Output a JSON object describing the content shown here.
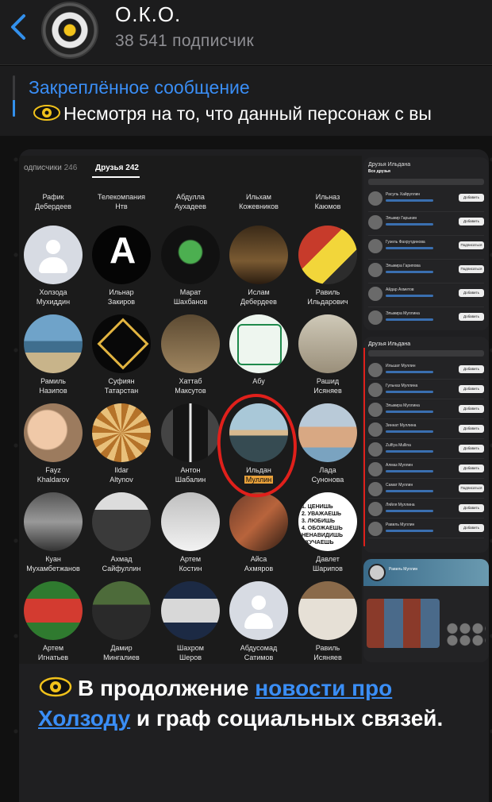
{
  "header": {
    "title": "О.К.О.",
    "subscribers": "38 541 подписчик"
  },
  "pinned": {
    "label": "Закреплённое сообщение",
    "text": "Несмотря на то, что данный персонаж с вы"
  },
  "screenshot_left": {
    "tabs": [
      {
        "label": "одписчики",
        "count": "246"
      },
      {
        "label": "Друзья",
        "count": "242"
      }
    ],
    "friends": [
      {
        "first": "Рафик",
        "last": "Дебердеев",
        "photo": "p-none"
      },
      {
        "first": "Телекомпания",
        "last": "Нтв",
        "photo": "p-none"
      },
      {
        "first": "Абдулла",
        "last": "Аухадеев",
        "photo": "p-none"
      },
      {
        "first": "Ильхам",
        "last": "Кожевников",
        "photo": "p-none"
      },
      {
        "first": "Ильназ",
        "last": "Каюмов",
        "photo": "p-none"
      },
      {
        "first": "Холзода",
        "last": "Мухиддин",
        "photo": "p-default"
      },
      {
        "first": "Ильнар",
        "last": "Закиров",
        "photo": "p-amigos"
      },
      {
        "first": "Марат",
        "last": "Шахбанов",
        "photo": "p-marat"
      },
      {
        "first": "Ислам",
        "last": "Дебердеев",
        "photo": "p-islam"
      },
      {
        "first": "Равиль",
        "last": "Ильдарович",
        "photo": "p-ravil"
      },
      {
        "first": "Рамиль",
        "last": "Назипов",
        "photo": "p-lake"
      },
      {
        "first": "Суфиян",
        "last": "Татарстан",
        "photo": "p-cube"
      },
      {
        "first": "Хаттаб",
        "last": "Максутов",
        "photo": "p-book"
      },
      {
        "first": "Абу",
        "last": "",
        "photo": "p-tovary"
      },
      {
        "first": "Рашид",
        "last": "Исяняев",
        "photo": "p-rashid"
      },
      {
        "first": "Fayz",
        "last": "Khaldarov",
        "photo": "p-baby"
      },
      {
        "first": "Ildar",
        "last": "Altynov",
        "photo": "p-mosaic"
      },
      {
        "first": "Антон",
        "last": "Шабалин",
        "photo": "p-anton"
      },
      {
        "first": "Ильдан",
        "last": "Муллин",
        "photo": "p-ildan"
      },
      {
        "first": "Лада",
        "last": "Сунонова",
        "photo": "p-lada"
      },
      {
        "first": "Куан",
        "last": "Мухамбетжанов",
        "photo": "p-kuan"
      },
      {
        "first": "Ахмад",
        "last": "Сайфуллин",
        "photo": "p-akhmad"
      },
      {
        "first": "Артем",
        "last": "Костин",
        "photo": "p-artem"
      },
      {
        "first": "Айса",
        "last": "Ахмяров",
        "photo": "p-aisa"
      },
      {
        "first": "Давлет",
        "last": "Шарипов",
        "photo": "p-menu"
      },
      {
        "first": "Артем",
        "last": "Игнатьев",
        "photo": "p-soccer"
      },
      {
        "first": "Дамир",
        "last": "Мингалиев",
        "photo": "p-damir"
      },
      {
        "first": "Шахром",
        "last": "Шеров",
        "photo": "p-shakhrom"
      },
      {
        "first": "Абдусомад",
        "last": "Сатимов",
        "photo": "p-default"
      },
      {
        "first": "Равиль",
        "last": "Исяняев",
        "photo": "p-davlet"
      }
    ],
    "menu_card_lines": [
      "1. ЦЕНИШЬ",
      "2. УВАЖАЕШЬ",
      "3. ЛЮБИШЬ",
      "4. ОБОЖАЕШЬ",
      "НЕНАВИДИШЬ",
      "СКУЧАЕШЬ"
    ]
  },
  "screenshot_right": {
    "panel1_title": "Друзья Ильдана",
    "panel1_tabs": "Все друзья",
    "panel1_rows": [
      {
        "name": "Расуль Хайруллин",
        "button": "Добавить"
      },
      {
        "name": "Эльмир Гарынин",
        "button": "Добавить"
      },
      {
        "name": "Гузель Фахрутдинова",
        "button": "Подписаться"
      },
      {
        "name": "Эльмира Гарипова",
        "button": "Подписаться"
      },
      {
        "name": "Айдар Ахметов",
        "button": "Добавить"
      },
      {
        "name": "Эльмира Муллина",
        "button": "Добавить"
      }
    ],
    "panel2_title": "Друзья Ильдана",
    "panel2_rows": [
      {
        "name": "Ильшат Муллин",
        "button": "Добавить"
      },
      {
        "name": "Гульназ Муллина",
        "button": "Добавить"
      },
      {
        "name": "Эльмира Муллина",
        "button": "Добавить"
      },
      {
        "name": "Зиннат Муллина",
        "button": "Добавить"
      },
      {
        "name": "Zulfiya Mullina",
        "button": "Добавить"
      },
      {
        "name": "Алмаз Муллин",
        "button": "Добавить"
      },
      {
        "name": "Самат Муллин",
        "button": "Подписаться"
      },
      {
        "name": "Ляйля Муллина",
        "button": "Добавить"
      },
      {
        "name": "Равиль Муллин",
        "button": "Добавить"
      }
    ],
    "panel3_name": "Равиль Муллин"
  },
  "caption": {
    "before": "В продолжение ",
    "link": "новости про Холзоду",
    "after": " и граф социальных связей."
  },
  "colors": {
    "accent": "#3a8ef6",
    "red_mark": "#e0201b",
    "bubble": "#1f1f21",
    "header": "#1c1c1d"
  }
}
